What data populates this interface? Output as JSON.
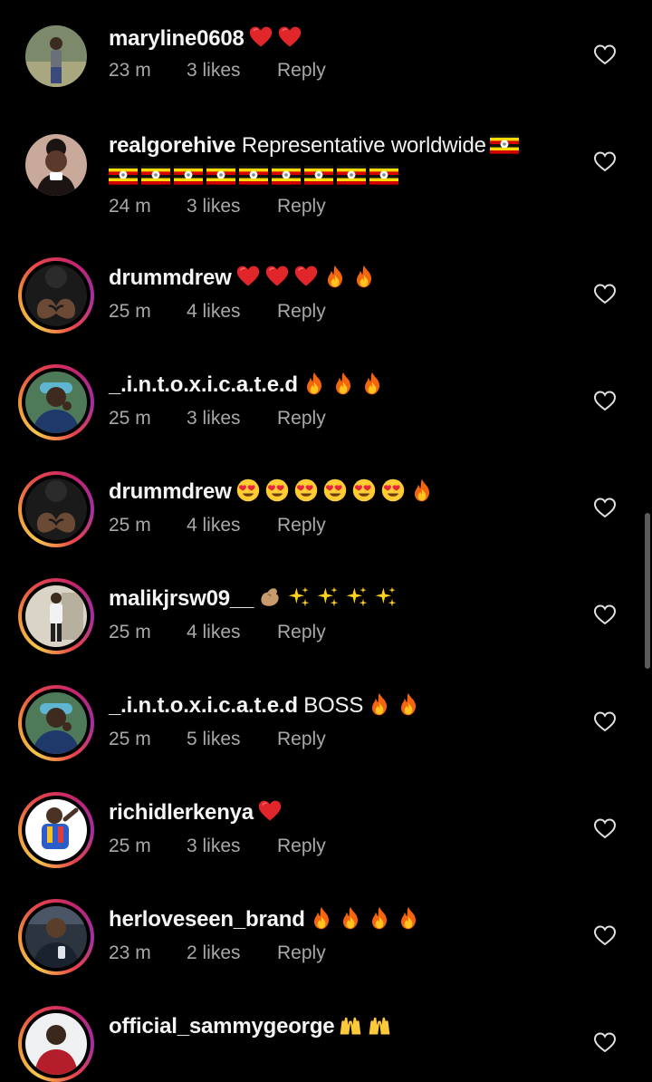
{
  "comments": [
    {
      "username": "maryline0608",
      "text": "",
      "text2": "",
      "emojis": [
        "red-heart",
        "red-heart"
      ],
      "emojis2": [],
      "time": "23 m",
      "likes": "3 likes",
      "reply": "Reply",
      "story_ring": false,
      "avatar_icon": "avatar-photo-woman-outdoor"
    },
    {
      "username": "realgorehive",
      "text": "Representative worldwide",
      "text2": "",
      "emojis": [
        "uganda-flag"
      ],
      "emojis2": [
        "uganda-flag",
        "uganda-flag",
        "uganda-flag",
        "uganda-flag",
        "uganda-flag",
        "uganda-flag",
        "uganda-flag",
        "uganda-flag",
        "uganda-flag"
      ],
      "time": "24 m",
      "likes": "3 likes",
      "reply": "Reply",
      "story_ring": false,
      "avatar_icon": "avatar-illustration-woman"
    },
    {
      "username": "drummdrew",
      "text": "",
      "text2": "",
      "emojis": [
        "red-heart",
        "red-heart",
        "red-heart",
        "fire",
        "fire"
      ],
      "emojis2": [],
      "time": "25 m",
      "likes": "4 likes",
      "reply": "Reply",
      "story_ring": true,
      "avatar_icon": "avatar-photo-heart-hands"
    },
    {
      "username": "_.i.n.t.o.x.i.c.a.t.e.d",
      "text": "",
      "text2": "",
      "emojis": [
        "fire",
        "fire",
        "fire"
      ],
      "emojis2": [],
      "time": "25 m",
      "likes": "3 likes",
      "reply": "Reply",
      "story_ring": true,
      "avatar_icon": "avatar-photo-man-cap"
    },
    {
      "username": "drummdrew",
      "text": "",
      "text2": "",
      "emojis": [
        "heart-eyes",
        "heart-eyes",
        "heart-eyes",
        "heart-eyes",
        "heart-eyes",
        "heart-eyes",
        "fire"
      ],
      "emojis2": [],
      "time": "25 m",
      "likes": "4 likes",
      "reply": "Reply",
      "story_ring": true,
      "avatar_icon": "avatar-photo-heart-hands"
    },
    {
      "username": "malikjrsw09__",
      "text": "",
      "text2": "",
      "emojis": [
        "pinching-hand",
        "sparkles",
        "sparkles",
        "sparkles",
        "sparkles"
      ],
      "emojis2": [],
      "time": "25 m",
      "likes": "4 likes",
      "reply": "Reply",
      "story_ring": true,
      "avatar_icon": "avatar-photo-man-standing"
    },
    {
      "username": "_.i.n.t.o.x.i.c.a.t.e.d",
      "text": "BOSS",
      "text2": "",
      "emojis": [
        "fire",
        "fire"
      ],
      "emojis2": [],
      "time": "25 m",
      "likes": "5 likes",
      "reply": "Reply",
      "story_ring": true,
      "avatar_icon": "avatar-photo-man-cap"
    },
    {
      "username": "richidlerkenya",
      "text": "",
      "text2": "",
      "emojis": [
        "red-heart"
      ],
      "emojis2": [],
      "time": "25 m",
      "likes": "3 likes",
      "reply": "Reply",
      "story_ring": true,
      "avatar_icon": "avatar-photo-man-colorful"
    },
    {
      "username": "herloveseen_brand",
      "text": "",
      "text2": "",
      "emojis": [
        "fire",
        "fire",
        "fire",
        "fire"
      ],
      "emojis2": [],
      "time": "23 m",
      "likes": "2 likes",
      "reply": "Reply",
      "story_ring": true,
      "avatar_icon": "avatar-photo-man-dark"
    },
    {
      "username": "official_sammygeorge",
      "text": "",
      "text2": "",
      "emojis": [
        "raising-hands",
        "raising-hands"
      ],
      "emojis2": [],
      "time": "",
      "likes": "",
      "reply": "",
      "story_ring": true,
      "avatar_icon": "avatar-photo-man-white"
    }
  ],
  "like_icon": "heart-outline-icon",
  "colors": {
    "background": "#000000",
    "text": "#f5f5f5",
    "meta": "#a8a8a8",
    "heart_outline": "#e0e0e0"
  }
}
